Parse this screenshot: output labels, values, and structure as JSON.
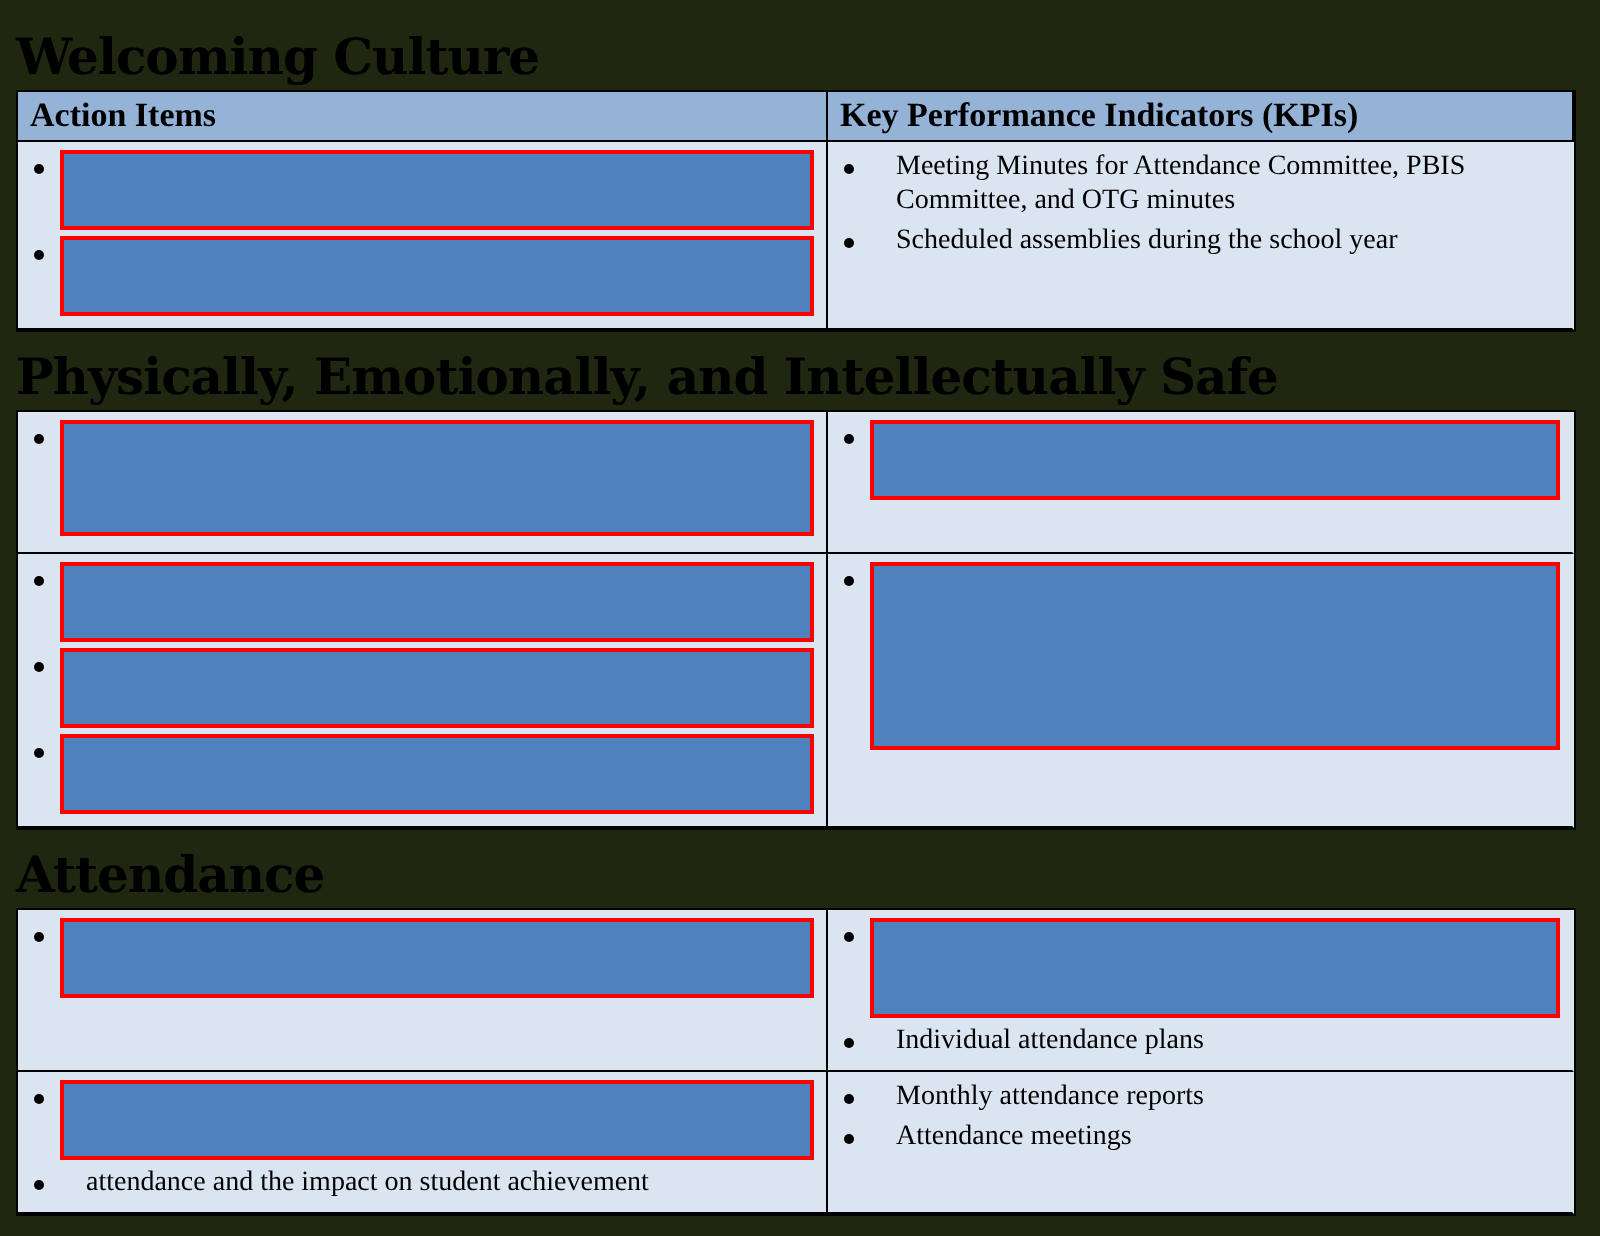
{
  "sections": [
    {
      "title": "Welcoming Culture",
      "columns": [
        "Action Items",
        "Key Performance Indicators (KPIs)"
      ],
      "rows": [
        {
          "cells": [
            [
              {
                "kind": "short-redaction"
              },
              {
                "kind": "short-redaction"
              }
            ],
            [
              {
                "kind": "text",
                "text": "Meeting Minutes for Attendance Committee, PBIS Committee, and OTG minutes"
              },
              {
                "kind": "text",
                "text": "Scheduled assemblies during the school year"
              }
            ]
          ]
        }
      ]
    },
    {
      "title": "Physically, Emotionally, and Intellectually Safe",
      "rows": [
        {
          "cells": [
            [
              {
                "kind": "tall-redaction"
              }
            ],
            [
              {
                "kind": "short-redaction"
              }
            ]
          ]
        },
        {
          "cells": [
            [
              {
                "kind": "short-redaction"
              },
              {
                "kind": "short-redaction"
              },
              {
                "kind": "short-redaction"
              }
            ],
            [
              {
                "kind": "huge-redaction"
              }
            ]
          ]
        }
      ]
    },
    {
      "title": "Attendance",
      "rows": [
        {
          "cells": [
            [
              {
                "kind": "short-redaction"
              }
            ],
            [
              {
                "kind": "medium-redaction"
              },
              {
                "kind": "text",
                "text": "Individual attendance plans"
              }
            ]
          ]
        },
        {
          "cells": [
            [
              {
                "kind": "short-redaction"
              },
              {
                "kind": "text",
                "text": "attendance and the impact on student achievement"
              }
            ],
            [
              {
                "kind": "text",
                "text": "Monthly attendance reports"
              },
              {
                "kind": "text",
                "text": "Attendance meetings"
              }
            ]
          ]
        }
      ]
    }
  ]
}
